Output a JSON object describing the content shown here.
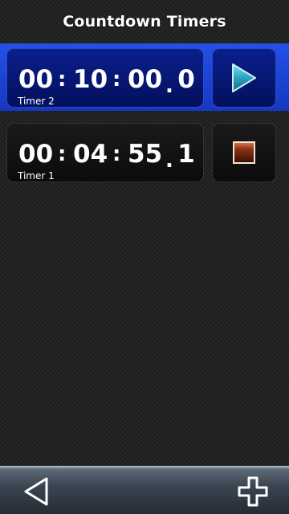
{
  "app": {
    "title": "Countdown Timers"
  },
  "timers": [
    {
      "label": "Timer 2",
      "hours": "00",
      "minutes": "10",
      "seconds": "00",
      "tenths": "0",
      "state": "stopped",
      "action_icon": "play-icon",
      "selected": true
    },
    {
      "label": "Timer 1",
      "hours": "00",
      "minutes": "04",
      "seconds": "55",
      "tenths": "1",
      "state": "running",
      "action_icon": "stop-icon",
      "selected": false
    }
  ],
  "separators": {
    "hm": ":",
    "ms": ":",
    "decimal": "."
  },
  "toolbar": {
    "back_icon": "back-arrow-icon",
    "add_icon": "plus-icon"
  },
  "colors": {
    "selection": "#1a43d4",
    "selected_box": "#05177a",
    "play_accent": "#2aa3c2",
    "stop_accent": "#7a2a12"
  }
}
